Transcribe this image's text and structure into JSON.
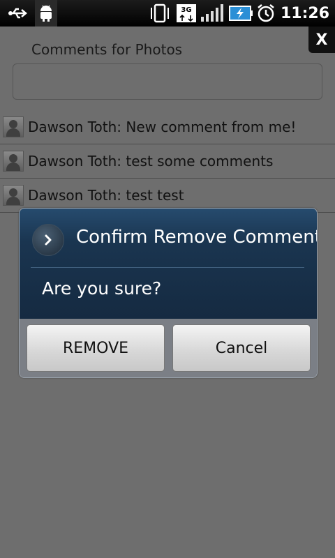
{
  "status_bar": {
    "time": "11:26",
    "network": "3G",
    "icons": [
      "usb-icon",
      "android-debug-icon",
      "vibrate-icon",
      "3g-icon",
      "signal-icon",
      "battery-charging-icon",
      "alarm-icon"
    ]
  },
  "close_label": "X",
  "comments": {
    "title": "Comments for Photos",
    "input_value": "",
    "items": [
      {
        "text": "Dawson Toth: New comment from me!"
      },
      {
        "text": "Dawson Toth: test some comments"
      },
      {
        "text": "Dawson Toth: test test"
      }
    ]
  },
  "dialog": {
    "title": "Confirm Remove Comment",
    "message": "Are you sure?",
    "icon": "chevron-right-icon",
    "buttons": {
      "remove": "REMOVE",
      "cancel": "Cancel"
    }
  },
  "colors": {
    "background": "#6e6e6e",
    "dialog_header": "#1a3550",
    "status_bar": "#000000"
  }
}
